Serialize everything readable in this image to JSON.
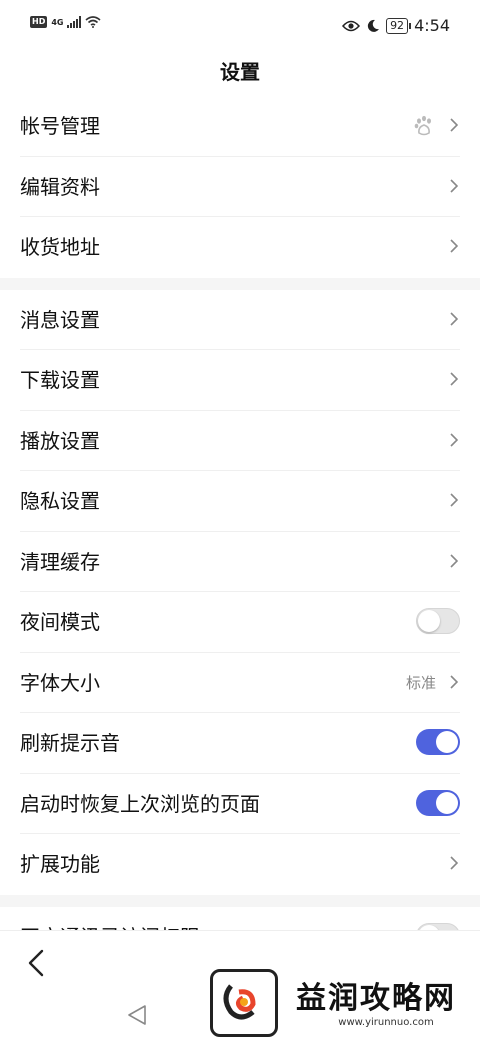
{
  "status_bar": {
    "network": "4G",
    "battery": "92",
    "time": "4:54"
  },
  "header": {
    "title": "设置"
  },
  "groups": [
    [
      {
        "label": "帐号管理",
        "type": "link",
        "icon": "paw-icon"
      },
      {
        "label": "编辑资料",
        "type": "link"
      },
      {
        "label": "收货地址",
        "type": "link"
      }
    ],
    [
      {
        "label": "消息设置",
        "type": "link"
      },
      {
        "label": "下载设置",
        "type": "link"
      },
      {
        "label": "播放设置",
        "type": "link"
      },
      {
        "label": "隐私设置",
        "type": "link"
      },
      {
        "label": "清理缓存",
        "type": "link"
      },
      {
        "label": "夜间模式",
        "type": "toggle",
        "on": false
      },
      {
        "label": "字体大小",
        "type": "link",
        "value": "标准"
      },
      {
        "label": "刷新提示音",
        "type": "toggle",
        "on": true
      },
      {
        "label": "启动时恢复上次浏览的页面",
        "type": "toggle",
        "on": true
      },
      {
        "label": "扩展功能",
        "type": "link"
      }
    ],
    [
      {
        "label": "开启通讯录访问权限",
        "type": "toggle",
        "on": false
      }
    ]
  ],
  "colors": {
    "accent": "#4f63de",
    "toggle_off": "#e6e6e6",
    "separator": "#f5f5f5"
  },
  "watermark": {
    "name": "益润攻略网",
    "url": "www.yirunnuo.com"
  }
}
